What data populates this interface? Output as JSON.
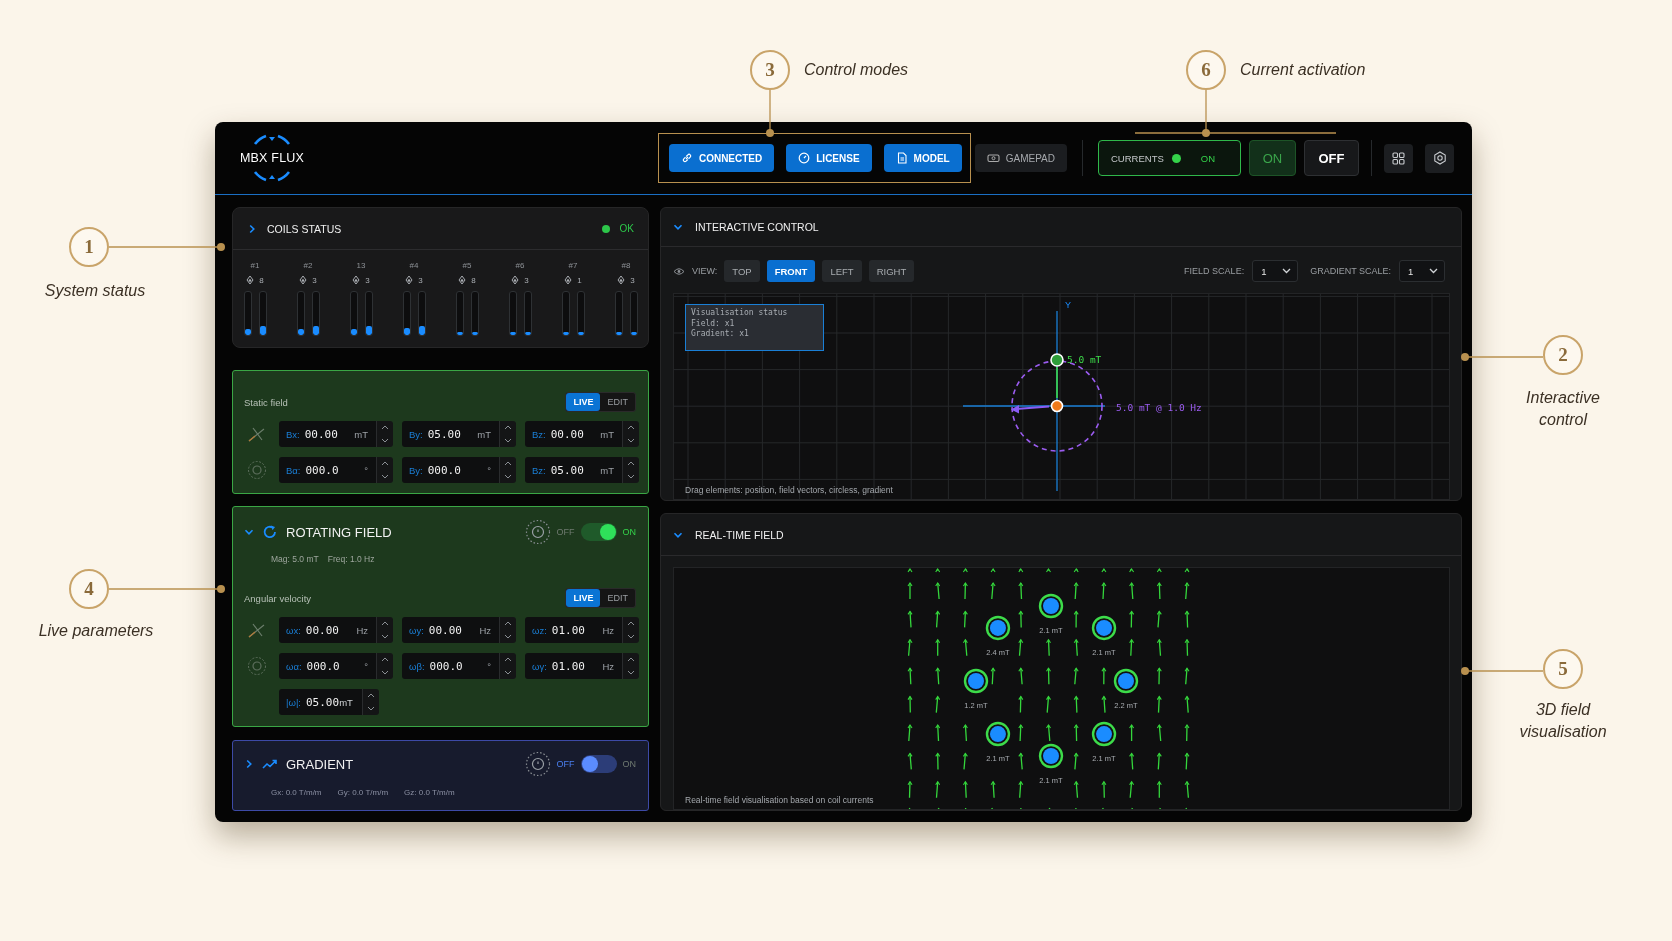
{
  "annotations": [
    {
      "number": "3",
      "label": "Control modes"
    },
    {
      "number": "6",
      "label": "Current activation"
    },
    {
      "number": "1",
      "label": "System status"
    },
    {
      "number": "4",
      "label": "Live parameters"
    },
    {
      "number": "2",
      "label": "Interactive control"
    },
    {
      "number": "5",
      "label": "3D field visualisation"
    }
  ],
  "header": {
    "app_name": "MBX FLUX",
    "mode_buttons": [
      {
        "label": "CONNECTED",
        "selected": true
      },
      {
        "label": "LICENSE",
        "selected": true
      },
      {
        "label": "MODEL",
        "selected": true
      },
      {
        "label": "GAMEPAD",
        "selected": false
      }
    ],
    "currents": {
      "label": "CURRENTS",
      "on": true,
      "state": "ON"
    },
    "power_buttons": [
      {
        "label": "ON",
        "kind": "on"
      },
      {
        "label": "OFF",
        "kind": "off"
      }
    ]
  },
  "coils_status": {
    "title": "COILS STATUS",
    "expanded": false,
    "ok": true,
    "status": "OK",
    "coils": [
      {
        "label": "#1",
        "reading": "8",
        "bars": [
          {
            "level": 0.14
          },
          {
            "level": 0.2
          }
        ]
      },
      {
        "label": "#2",
        "reading": "3",
        "bars": [
          {
            "level": 0.14
          },
          {
            "level": 0.2
          }
        ]
      },
      {
        "label": "13",
        "reading": "3",
        "bars": [
          {
            "level": 0.14
          },
          {
            "level": 0.2
          }
        ]
      },
      {
        "label": "#4",
        "reading": "3",
        "bars": [
          {
            "level": 0.16
          },
          {
            "level": 0.22
          }
        ]
      },
      {
        "label": "#5",
        "reading": "8",
        "bars": [
          {
            "level": 0.06
          },
          {
            "level": 0.06
          }
        ]
      },
      {
        "label": "#6",
        "reading": "3",
        "bars": [
          {
            "level": 0.06
          },
          {
            "level": 0.06
          }
        ]
      },
      {
        "label": "#7",
        "reading": "1",
        "bars": [
          {
            "level": 0.06
          },
          {
            "level": 0.06
          }
        ]
      },
      {
        "label": "#8",
        "reading": "3",
        "bars": [
          {
            "level": 0.06
          },
          {
            "level": 0.06
          }
        ]
      }
    ]
  },
  "static_field": {
    "title": "Static field",
    "modes": [
      {
        "label": "LIVE",
        "selected": true
      },
      {
        "label": "EDIT",
        "selected": false
      }
    ],
    "rows": [
      {
        "fields": [
          {
            "label": "Bx:",
            "value": "00.00",
            "unit": "mT"
          },
          {
            "label": "By:",
            "value": "05.00",
            "unit": "mT"
          },
          {
            "label": "Bz:",
            "value": "00.00",
            "unit": "mT"
          }
        ]
      },
      {
        "fields": [
          {
            "label": "Bα:",
            "value": "000.0",
            "unit": "°"
          },
          {
            "label": "By:",
            "value": "000.0",
            "unit": "°"
          },
          {
            "label": "Bz:",
            "value": "05.00",
            "unit": "mT"
          }
        ]
      }
    ]
  },
  "rotating_field": {
    "title": "ROTATING FIELD",
    "expanded": true,
    "enabled": true,
    "off_label": "OFF",
    "on_label": "ON",
    "summary": [
      "Mag: 5.0 mT",
      "Freq: 1.0 Hz"
    ],
    "section": "Angular velocity",
    "modes": [
      {
        "label": "LIVE",
        "selected": true
      },
      {
        "label": "EDIT",
        "selected": false
      }
    ],
    "rows": [
      {
        "fields": [
          {
            "label": "ωx:",
            "value": "00.00",
            "unit": "Hz"
          },
          {
            "label": "ωy:",
            "value": "00.00",
            "unit": "Hz"
          },
          {
            "label": "ωz:",
            "value": "01.00",
            "unit": "Hz"
          }
        ]
      },
      {
        "fields": [
          {
            "label": "ωα:",
            "value": "000.0",
            "unit": "°"
          },
          {
            "label": "ωβ:",
            "value": "000.0",
            "unit": "°"
          },
          {
            "label": "ωγ:",
            "value": "01.00",
            "unit": "Hz"
          }
        ]
      }
    ],
    "magnitude_field": {
      "label": "|ω|:",
      "value": "05.00",
      "unit": "mT"
    }
  },
  "gradient": {
    "title": "GRADIENT",
    "expanded": false,
    "enabled": false,
    "off_label": "OFF",
    "on_label": "ON",
    "summary": [
      "Gx: 0.0 T/m/m",
      "Gy: 0.0 T/m/m",
      "Gz: 0.0 T/m/m"
    ]
  },
  "interactive_control": {
    "title": "INTERACTIVE CONTROL",
    "expanded": true,
    "view_label": "VIEW:",
    "views": [
      {
        "label": "TOP",
        "selected": false
      },
      {
        "label": "FRONT",
        "selected": true
      },
      {
        "label": "LEFT",
        "selected": false
      },
      {
        "label": "RIGHT",
        "selected": false
      }
    ],
    "scales": [
      {
        "label": "FIELD SCALE:",
        "value": "1"
      },
      {
        "label": "GRADIENT SCALE:",
        "value": "1"
      }
    ],
    "status_box": [
      "Visualisation status",
      "Field: x1",
      "Gradient: x1"
    ],
    "axis_label": "Y",
    "field_label": "5.0 mT",
    "rotation_label": "5.0 mT @ 1.0 Hz",
    "hint": "Drag elements: position, field vectors, circless, gradient"
  },
  "real_time_field": {
    "title": "REAL-TIME FIELD",
    "expanded": true,
    "coils": [
      {
        "label": "2.1 mT"
      },
      {
        "label": "2.1 mT"
      },
      {
        "label": "2.2 mT"
      },
      {
        "label": "2.1 mT"
      },
      {
        "label": "2.1 mT"
      },
      {
        "label": "2.1 mT"
      },
      {
        "label": "1.2 mT"
      },
      {
        "label": "2.4 mT"
      }
    ],
    "caption": "Real-time field visualisation based on coil currents"
  }
}
